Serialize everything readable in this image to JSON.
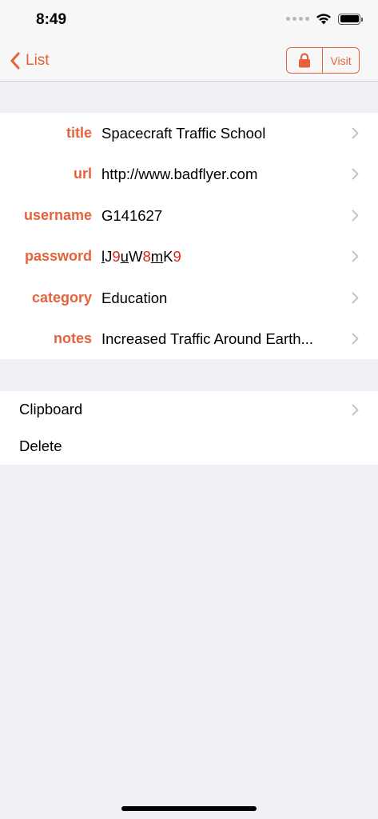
{
  "status_bar": {
    "time": "8:49",
    "icons": [
      "signal-dots-icon",
      "wifi-icon",
      "battery-icon"
    ]
  },
  "nav": {
    "back_label": "List",
    "lock_icon": "lock-icon",
    "visit_label": "Visit",
    "accent_color": "#e5623c"
  },
  "fields": [
    {
      "label": "title",
      "value": "Spacecraft Traffic School"
    },
    {
      "label": "url",
      "value": "http://www.badflyer.com"
    },
    {
      "label": "username",
      "value": "G141627"
    },
    {
      "label": "password",
      "value": "lJ9uW8mK9"
    },
    {
      "label": "category",
      "value": "Education"
    },
    {
      "label": "notes",
      "value": "Increased Traffic Around Earth..."
    }
  ],
  "password_chars": [
    {
      "c": "l",
      "digit": false,
      "underline": true
    },
    {
      "c": "J",
      "digit": false,
      "underline": false
    },
    {
      "c": "9",
      "digit": true,
      "underline": false
    },
    {
      "c": "u",
      "digit": false,
      "underline": true
    },
    {
      "c": "W",
      "digit": false,
      "underline": false
    },
    {
      "c": "8",
      "digit": true,
      "underline": false
    },
    {
      "c": "m",
      "digit": false,
      "underline": true
    },
    {
      "c": "K",
      "digit": false,
      "underline": false
    },
    {
      "c": "9",
      "digit": true,
      "underline": false
    }
  ],
  "actions": [
    {
      "label": "Clipboard",
      "has_chevron": true
    },
    {
      "label": "Delete",
      "has_chevron": false
    }
  ],
  "colors": {
    "accent": "#e5623c",
    "password_digit": "#e0241c",
    "background": "#efeff4"
  }
}
